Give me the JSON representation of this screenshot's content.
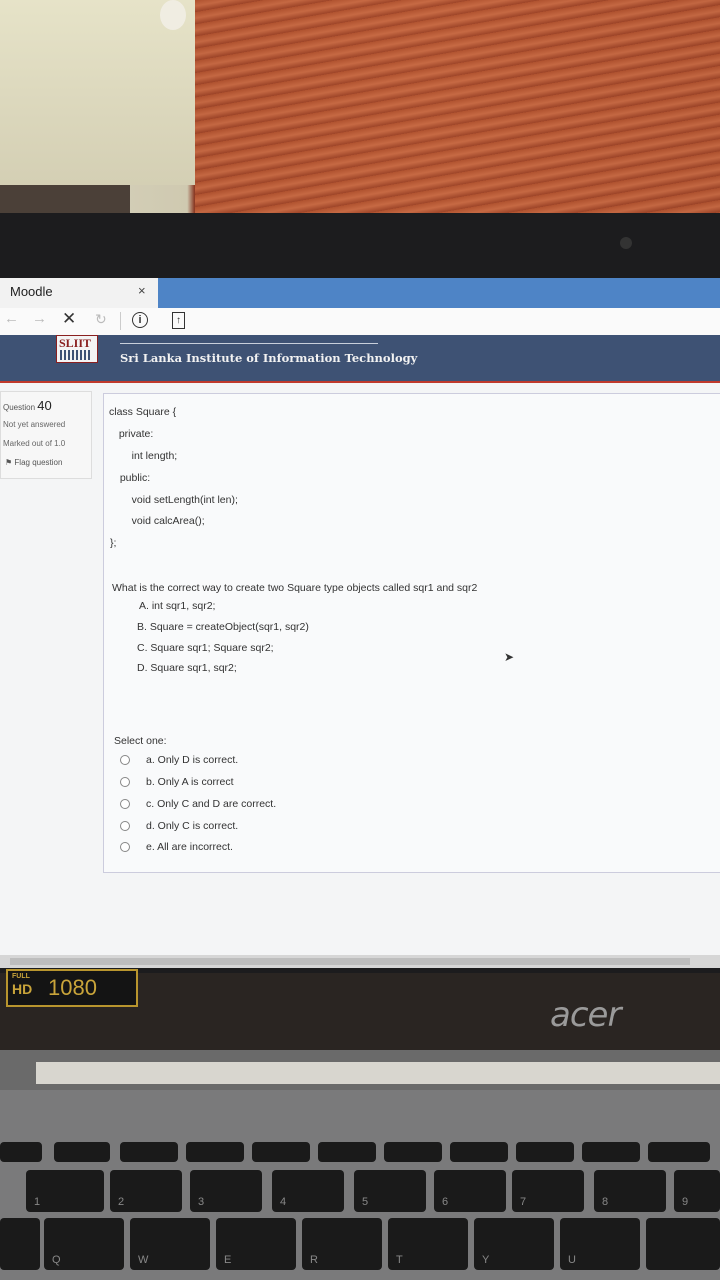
{
  "browser": {
    "tab_title": "Moodle",
    "tab_close": "×"
  },
  "banner": {
    "logo_text": "SLIIT",
    "institute_name": "Sri Lanka Institute of Information Technology"
  },
  "question_info": {
    "label": "Question",
    "number": "40",
    "status": "Not yet answered",
    "marks": "Marked out of 1.0",
    "flag_label": "Flag question"
  },
  "question": {
    "code_lines": [
      "class Square {",
      "  private:",
      "    int length;",
      "  public:",
      "    void setLength(int len);",
      "    void calcArea();",
      "};"
    ],
    "text": "What is the correct way to create two Square type objects called sqr1 and sqr2",
    "statements": [
      "A. int sqr1, sqr2;",
      "B. Square = createObject(sqr1, sqr2)",
      "C. Square sqr1; Square sqr2;",
      "D. Square sqr1, sqr2;"
    ],
    "select_label": "Select one:",
    "answers": [
      "a. Only D is correct.",
      "b. Only A is correct",
      "c. Only C and D are correct.",
      "d. Only C is correct.",
      "e. All are incorrect."
    ]
  },
  "laptop": {
    "badge_top": "FULL",
    "badge_hd": "HD",
    "badge_res": "1080",
    "brand": "acer"
  },
  "keyboard": {
    "row1": [
      "1",
      "2",
      "3",
      "4",
      "5",
      "6",
      "7",
      "8",
      "9"
    ],
    "row2": [
      "Q",
      "W",
      "E",
      "R",
      "T",
      "Y",
      "U"
    ]
  }
}
